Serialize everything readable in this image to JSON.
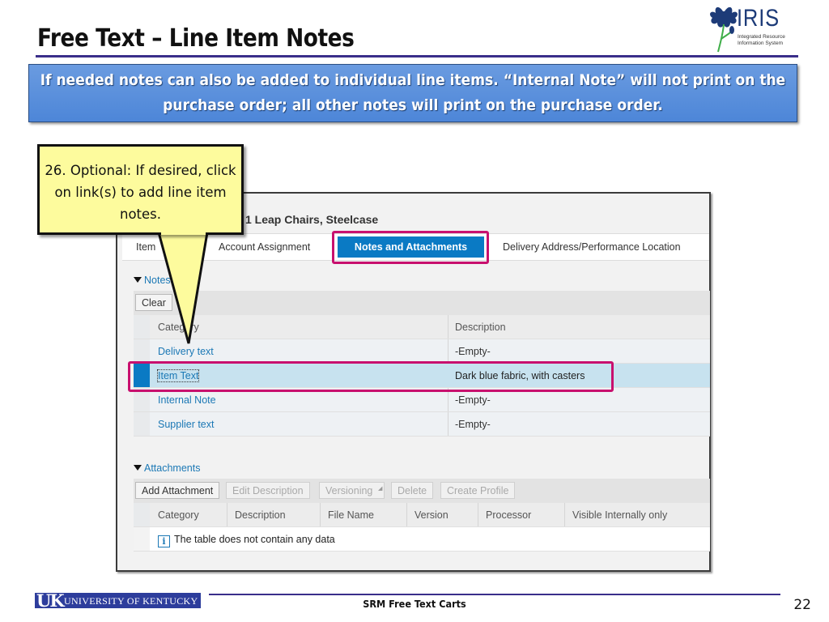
{
  "slide": {
    "title": "Free Text – Line Item Notes",
    "banner": "If needed notes can also be added to individual line items. “Internal Note” will not print on the purchase order; all other notes will print on the purchase order.",
    "logo": {
      "name": "IRIS",
      "subtitle_line1": "Integrated Resource",
      "subtitle_line2": "Information System"
    },
    "callout": "26. Optional: If desired, click on link(s) to add line item notes.",
    "footer": {
      "org": "UNIVERSITY OF KENTUCKY",
      "org_mark": "UK",
      "title": "SRM Free Text Carts",
      "page": "22"
    }
  },
  "sap": {
    "window_title": "1  Leap Chairs, Steelcase",
    "tabs": [
      {
        "label": "Item",
        "active": false
      },
      {
        "label": "Account Assignment",
        "active": false
      },
      {
        "label": "Notes and Attachments",
        "active": true
      },
      {
        "label": "Delivery Address/Performance Location",
        "active": false
      }
    ],
    "notes": {
      "section_label": "Notes",
      "clear_button": "Clear",
      "columns": [
        "Category",
        "Description"
      ],
      "rows": [
        {
          "category": "Delivery text",
          "description": "-Empty-",
          "selected": false
        },
        {
          "category": "Item Text",
          "description": "Dark blue fabric, with casters",
          "selected": true
        },
        {
          "category": "Internal Note",
          "description": "-Empty-",
          "selected": false
        },
        {
          "category": "Supplier text",
          "description": "-Empty-",
          "selected": false
        }
      ]
    },
    "attachments": {
      "section_label": "Attachments",
      "buttons": [
        {
          "label": "Add Attachment",
          "enabled": true
        },
        {
          "label": "Edit Description",
          "enabled": false
        },
        {
          "label": "Versioning",
          "enabled": false
        },
        {
          "label": "Delete",
          "enabled": false
        },
        {
          "label": "Create Profile",
          "enabled": false
        }
      ],
      "columns": [
        "Category",
        "Description",
        "File Name",
        "Version",
        "Processor",
        "Visible Internally only"
      ],
      "empty_message": "The table does not contain any data"
    }
  },
  "colors": {
    "highlight": "#c8106e",
    "sap_blue": "#0a7ac4",
    "link": "#1b78b5",
    "callout_fill": "#fdfb9d",
    "banner": "#5b8fdc",
    "title_rule": "#3a2e8a"
  }
}
